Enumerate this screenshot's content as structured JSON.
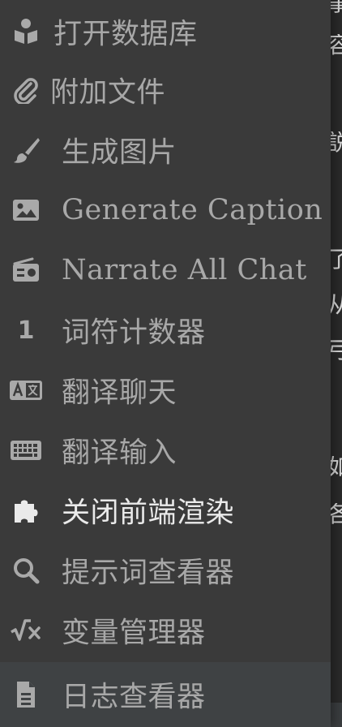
{
  "menu": {
    "items": [
      {
        "label": "打开数据库",
        "icon": "book-reader-icon"
      },
      {
        "label": "附加文件",
        "icon": "paperclip-icon"
      },
      {
        "label": "生成图片",
        "icon": "paintbrush-icon"
      },
      {
        "label": "Generate Caption",
        "icon": "image-icon"
      },
      {
        "label": "Narrate All Chat",
        "icon": "radio-icon"
      },
      {
        "label": "词符计数器",
        "icon": "number-one-icon",
        "icon_text": "1"
      },
      {
        "label": "翻译聊天",
        "icon": "translate-icon"
      },
      {
        "label": "翻译输入",
        "icon": "keyboard-icon"
      },
      {
        "label": "关闭前端渲染",
        "icon": "puzzle-piece-icon",
        "active": true
      },
      {
        "label": "提示词查看器",
        "icon": "magnifier-icon"
      },
      {
        "label": "变量管理器",
        "icon": "square-root-icon"
      },
      {
        "label": "日志查看器",
        "icon": "file-lines-icon"
      }
    ]
  },
  "background": {
    "edge_glyphs": [
      "事",
      "容",
      "説",
      "了",
      "从",
      "弓",
      "如",
      "各"
    ]
  },
  "colors": {
    "menu_bg": "#3a3a3a",
    "label": "#a8a8a8",
    "label_active": "#eaeaea",
    "page_bg": "#2a2a2a"
  }
}
